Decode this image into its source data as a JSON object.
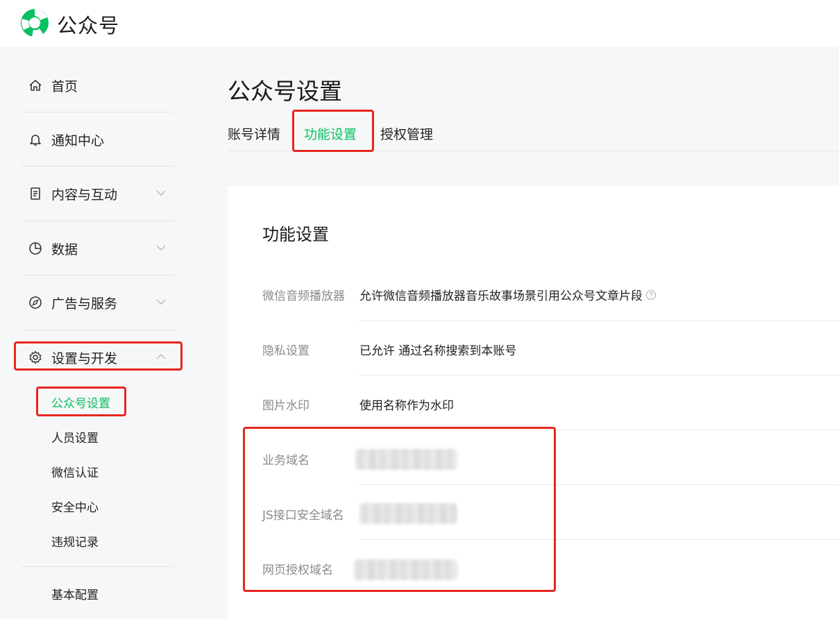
{
  "header": {
    "brand": "公众号",
    "logo_icon": "wechat-official-account-logo-icon",
    "brand_color": "#07c160"
  },
  "sidebar": {
    "items": [
      {
        "label": "首页",
        "icon": "home-icon"
      },
      {
        "label": "通知中心",
        "icon": "bell-icon"
      },
      {
        "label": "内容与互动",
        "icon": "document-icon",
        "expandable": true
      },
      {
        "label": "数据",
        "icon": "pie-chart-icon",
        "expandable": true
      },
      {
        "label": "广告与服务",
        "icon": "compass-icon",
        "expandable": true
      },
      {
        "label": "设置与开发",
        "icon": "gear-icon",
        "expanded": true
      }
    ],
    "sub_items": [
      {
        "label": "公众号设置",
        "active": true
      },
      {
        "label": "人员设置"
      },
      {
        "label": "微信认证"
      },
      {
        "label": "安全中心"
      },
      {
        "label": "违规记录"
      }
    ],
    "extra_items": [
      {
        "label": "基本配置"
      }
    ]
  },
  "main": {
    "page_title": "公众号设置",
    "tabs": [
      {
        "label": "账号详情"
      },
      {
        "label": "功能设置",
        "active": true
      },
      {
        "label": "授权管理"
      }
    ],
    "card": {
      "title": "功能设置",
      "rows": [
        {
          "label": "微信音频播放器",
          "value": "允许微信音频播放器音乐故事场景引用公众号文章片段",
          "help_icon": "question-circle-icon"
        },
        {
          "label": "隐私设置",
          "value": "已允许 通过名称搜索到本账号"
        },
        {
          "label": "图片水印",
          "value": "使用名称作为水印"
        },
        {
          "label": "业务域名",
          "value_blurred": true
        },
        {
          "label": "JS接口安全域名",
          "value_blurred": true
        },
        {
          "label": "网页授权域名",
          "value_blurred": true
        }
      ]
    }
  },
  "colors": {
    "accent": "#07c160",
    "highlight_box": "#e8261f",
    "background": "#f6f7f9"
  }
}
